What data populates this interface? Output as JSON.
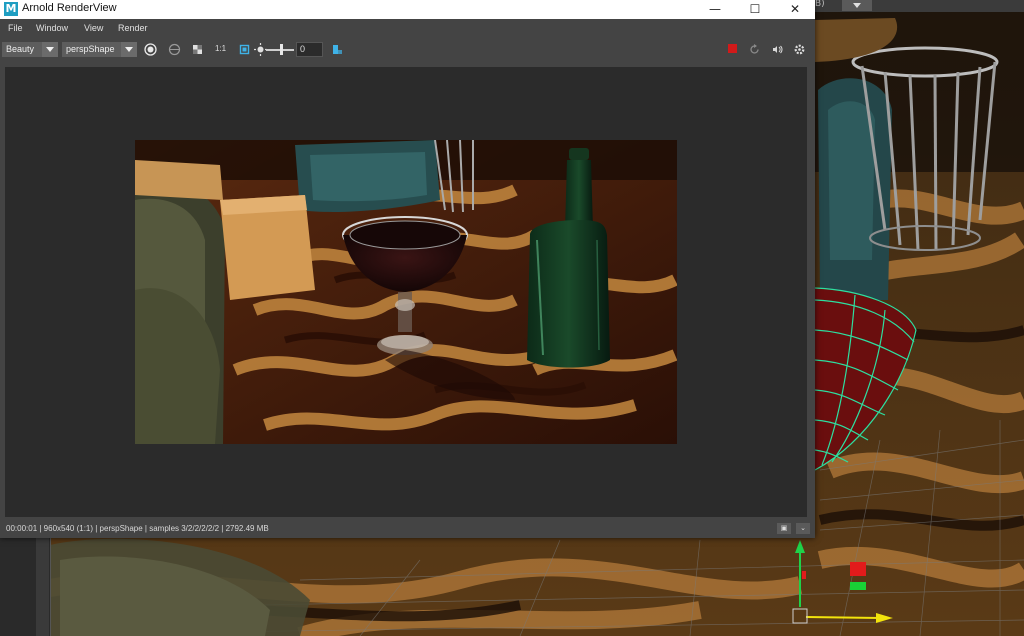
{
  "window": {
    "title": "Arnold RenderView",
    "app_icon_letter": "M",
    "controls": {
      "minimize": "—",
      "maximize": "☐",
      "close": "✕"
    }
  },
  "menubar": {
    "items": [
      "File",
      "Window",
      "View",
      "Render"
    ]
  },
  "toolbar": {
    "aov_value": "Beauty",
    "camera_value": "perspShape",
    "one_to_one_label": "1:1",
    "exposure_value": "0"
  },
  "statusbar": {
    "text": "00:00:01 | 960x540 (1:1) | perspShape  | samples 3/2/2/2/2/2 | 2792.49 MB"
  },
  "viewport": {
    "topbar_label": "B)"
  },
  "colors": {
    "window_bg": "#444444",
    "render_bg": "#2b2b2b",
    "accent_blue": "#1e9ec2",
    "stop_red": "#d11a1a",
    "wire_green": "#2de0a0"
  },
  "icons": [
    "run-render-icon",
    "region-icon",
    "checker-icon",
    "crop-icon",
    "exposure-icon",
    "snapshot-icon",
    "stop-icon",
    "refresh-icon",
    "ipr-icon",
    "settings-icon"
  ]
}
